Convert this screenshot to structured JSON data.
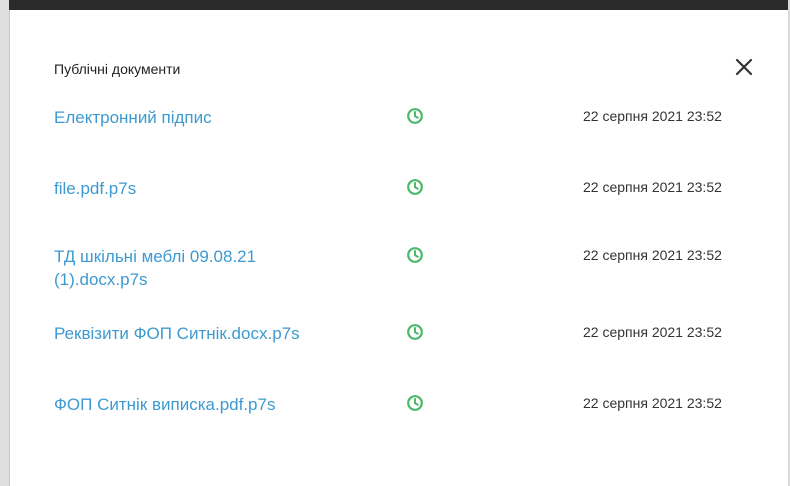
{
  "dialog": {
    "title": "Публічні документи",
    "close_icon": "close-icon",
    "status_icon": "clock-icon",
    "colors": {
      "link": "#3d9ad1",
      "status": "#4cb86a",
      "text": "#222222"
    },
    "documents": [
      {
        "name": "Електронний підпис",
        "date": "22 серпня 2021 23:52"
      },
      {
        "name": "file.pdf.p7s",
        "date": "22 серпня 2021 23:52"
      },
      {
        "name": "ТД шкільні меблі 09.08.21 (1).docx.p7s",
        "date": "22 серпня 2021 23:52"
      },
      {
        "name": "Реквізити ФОП Ситнік.docx.p7s",
        "date": "22 серпня 2021 23:52"
      },
      {
        "name": "ФОП Ситнік виписка.pdf.p7s",
        "date": "22 серпня 2021 23:52"
      }
    ]
  }
}
